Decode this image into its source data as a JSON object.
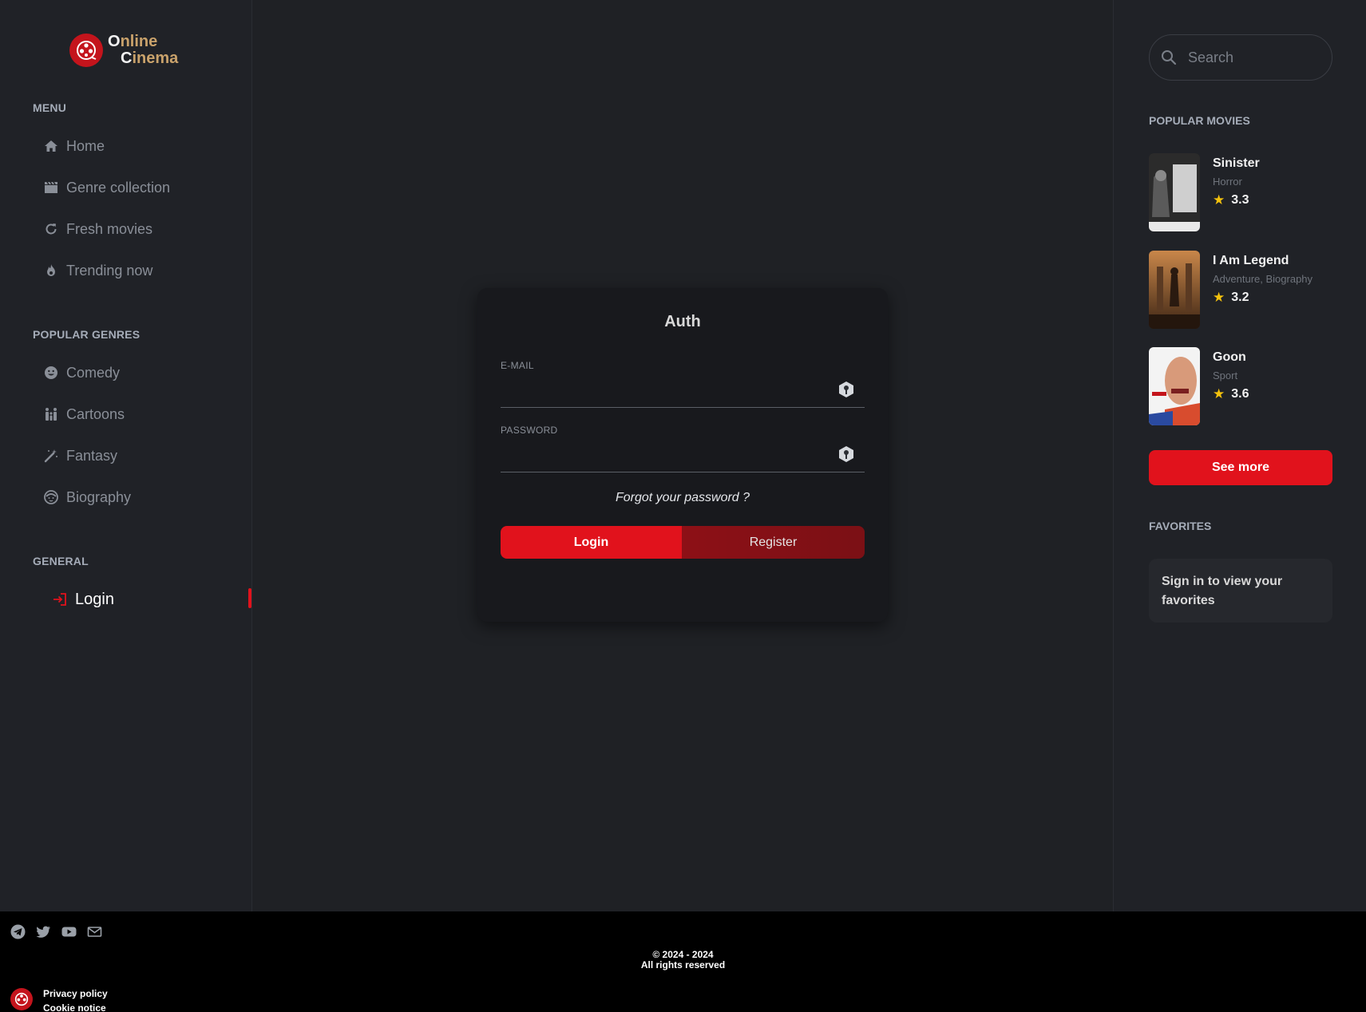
{
  "logo": {
    "line1_a": "O",
    "line1_b": "nline",
    "line2_a": "C",
    "line2_b": "inema",
    "icon": "film-reel-icon"
  },
  "menu": {
    "title": "MENU",
    "items": [
      {
        "label": "Home",
        "icon": "home-icon"
      },
      {
        "label": "Genre collection",
        "icon": "clapperboard-icon"
      },
      {
        "label": "Fresh movies",
        "icon": "refresh-icon"
      },
      {
        "label": "Trending now",
        "icon": "fire-icon"
      }
    ]
  },
  "genres": {
    "title": "POPULAR GENRES",
    "items": [
      {
        "label": "Comedy",
        "icon": "smile-icon"
      },
      {
        "label": "Cartoons",
        "icon": "family-icon"
      },
      {
        "label": "Fantasy",
        "icon": "magic-wand-icon"
      },
      {
        "label": "Biography",
        "icon": "baby-face-icon"
      }
    ]
  },
  "general": {
    "title": "GENERAL",
    "items": [
      {
        "label": "Login",
        "icon": "login-icon",
        "active": true
      }
    ]
  },
  "auth": {
    "title": "Auth",
    "email_label": "E-MAIL",
    "email_value": "",
    "password_label": "PASSWORD",
    "password_value": "",
    "forgot": "Forgot your password ?",
    "login_label": "Login",
    "register_label": "Register"
  },
  "search": {
    "placeholder": "Search"
  },
  "popular": {
    "title": "POPULAR MOVIES",
    "movies": [
      {
        "title": "Sinister",
        "genre": "Horror",
        "rating": "3.3"
      },
      {
        "title": "I Am Legend",
        "genre": "Adventure, Biography",
        "rating": "3.2"
      },
      {
        "title": "Goon",
        "genre": "Sport",
        "rating": "3.6"
      }
    ],
    "see_more": "See more"
  },
  "favorites": {
    "title": "FAVORITES",
    "message": "Sign in to view your favorites"
  },
  "footer": {
    "copyright": "© 2024 - 2024",
    "rights": "All rights reserved",
    "privacy": "Privacy policy",
    "cookie": "Cookie notice",
    "socials": [
      "telegram-icon",
      "twitter-icon",
      "youtube-icon",
      "mail-icon"
    ]
  },
  "colors": {
    "accent": "#e1121c",
    "background": "#1f2125",
    "panel": "#202227",
    "card": "#18191d",
    "gold": "#c9a26b"
  }
}
